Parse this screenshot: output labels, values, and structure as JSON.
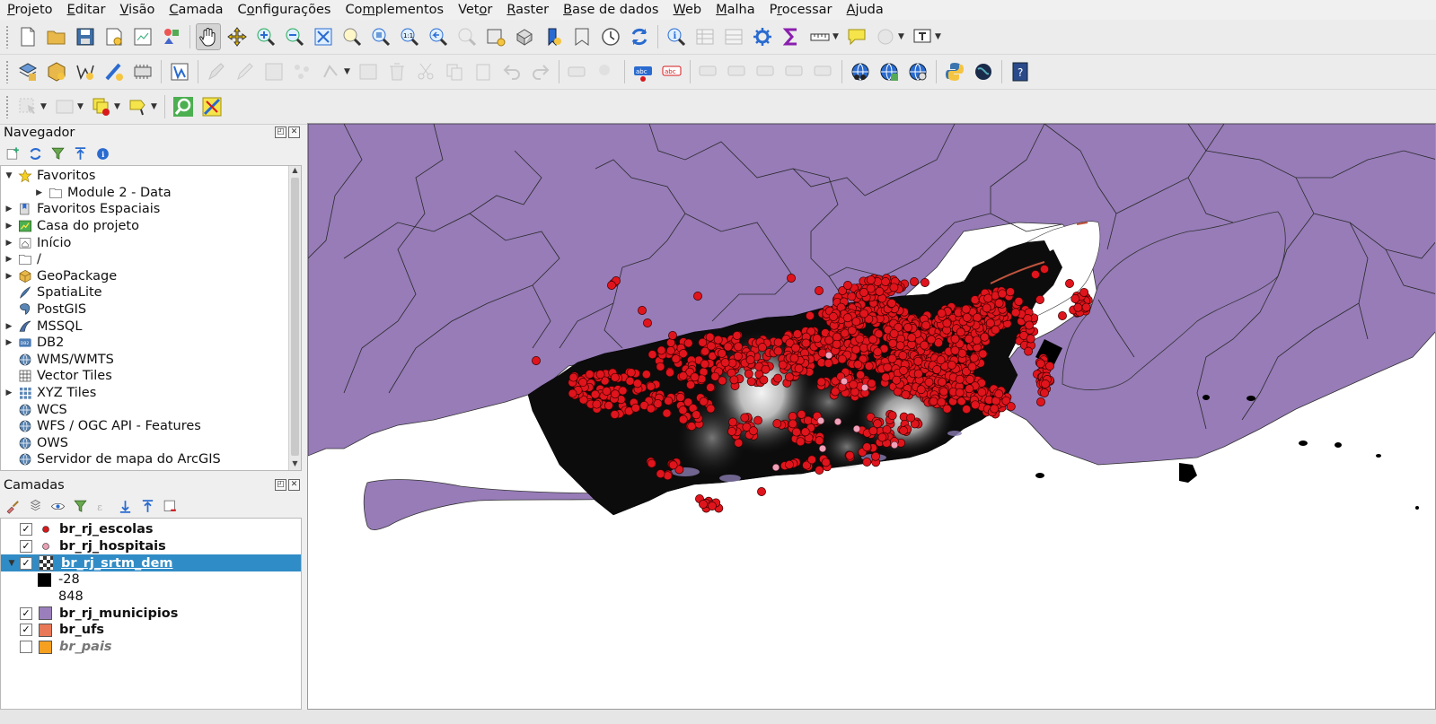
{
  "menu": [
    {
      "label": "Projeto",
      "u": "P"
    },
    {
      "label": "Editar",
      "u": "E"
    },
    {
      "label": "Visão",
      "u": "V"
    },
    {
      "label": "Camada",
      "u": "C"
    },
    {
      "label": "Configurações",
      "u": "o"
    },
    {
      "label": "Complementos",
      "u": "m"
    },
    {
      "label": "Vetor",
      "u": "o"
    },
    {
      "label": "Raster",
      "u": "R"
    },
    {
      "label": "Base de dados",
      "u": "B"
    },
    {
      "label": "Web",
      "u": "W"
    },
    {
      "label": "Malha",
      "u": "M"
    },
    {
      "label": "Processar",
      "u": "r"
    },
    {
      "label": "Ajuda",
      "u": "A"
    }
  ],
  "browser": {
    "title": "Navegador",
    "items": [
      {
        "label": "Favoritos",
        "icon": "star-icon",
        "expanded": true,
        "level": 0
      },
      {
        "label": "Module 2 - Data",
        "icon": "folder-icon",
        "level": 1
      },
      {
        "label": "Favoritos Espaciais",
        "icon": "spatial-bookmark-icon",
        "level": 0
      },
      {
        "label": "Casa do projeto",
        "icon": "project-home-icon",
        "level": 0
      },
      {
        "label": "Início",
        "icon": "home-folder-icon",
        "level": 0
      },
      {
        "label": "/",
        "icon": "folder-icon",
        "level": 0
      },
      {
        "label": "GeoPackage",
        "icon": "geopackage-icon",
        "level": 0
      },
      {
        "label": "SpatiaLite",
        "icon": "spatialite-icon",
        "level": 0,
        "noarrow": true
      },
      {
        "label": "PostGIS",
        "icon": "postgis-icon",
        "level": 0,
        "noarrow": true
      },
      {
        "label": "MSSQL",
        "icon": "mssql-icon",
        "level": 0
      },
      {
        "label": "DB2",
        "icon": "db2-icon",
        "level": 0
      },
      {
        "label": "WMS/WMTS",
        "icon": "wms-icon",
        "level": 0,
        "noarrow": true
      },
      {
        "label": "Vector Tiles",
        "icon": "vector-tiles-icon",
        "level": 0,
        "noarrow": true
      },
      {
        "label": "XYZ Tiles",
        "icon": "xyz-tiles-icon",
        "level": 0
      },
      {
        "label": "WCS",
        "icon": "wcs-icon",
        "level": 0,
        "noarrow": true
      },
      {
        "label": "WFS / OGC API - Features",
        "icon": "wfs-icon",
        "level": 0,
        "noarrow": true
      },
      {
        "label": "OWS",
        "icon": "ows-icon",
        "level": 0,
        "noarrow": true
      },
      {
        "label": "Servidor de mapa do ArcGIS",
        "icon": "arcgis-icon",
        "level": 0,
        "noarrow": true
      }
    ]
  },
  "layers": {
    "title": "Camadas",
    "items": [
      {
        "label": "br_rj_escolas",
        "checked": true,
        "symbol": "point",
        "color": "#d7191c"
      },
      {
        "label": "br_rj_hospitais",
        "checked": true,
        "symbol": "point",
        "color": "#e8a0b4"
      },
      {
        "label": "br_rj_srtm_dem",
        "checked": true,
        "symbol": "raster",
        "selected": true
      },
      {
        "label": "-28",
        "legend": true,
        "color": "#000000"
      },
      {
        "label": "848",
        "legend": true,
        "color": "#ffffff"
      },
      {
        "label": "br_rj_municipios",
        "checked": true,
        "symbol": "fill",
        "color": "#9b7fbc"
      },
      {
        "label": "br_ufs",
        "checked": true,
        "symbol": "fill",
        "color": "#e87858"
      },
      {
        "label": "br_pais",
        "checked": false,
        "symbol": "fill",
        "color": "#f5a020",
        "italic": true
      }
    ]
  },
  "colors": {
    "municipios": "#977cb8",
    "escolas": "#e0141c",
    "hospitais": "#f0a0b8",
    "selection": "#308cc6"
  }
}
